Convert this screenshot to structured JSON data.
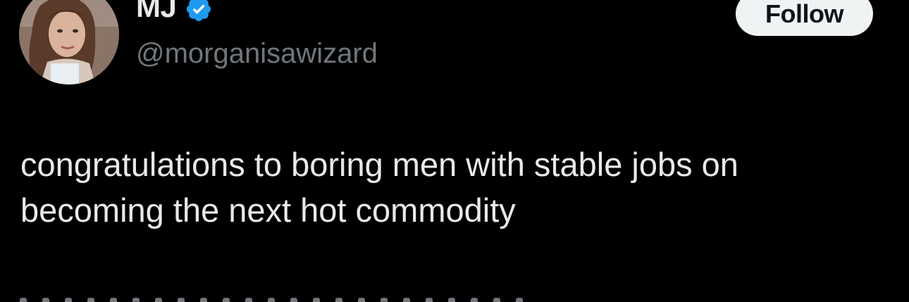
{
  "tweet": {
    "author": {
      "display_name": "MJ",
      "handle": "@morganisawizard",
      "verified_icon": "verified-badge-icon",
      "avatar": "profile-photo"
    },
    "follow_label": "Follow",
    "text": "congratulations to boring men with stable jobs on\nbecoming the next hot commodity"
  },
  "colors": {
    "background": "#000000",
    "primary_text": "#e7e9ea",
    "secondary_text": "#71767b",
    "verified_blue": "#1d9bf0",
    "follow_button_bg": "#eff3f4",
    "follow_button_text": "#0f1419"
  }
}
